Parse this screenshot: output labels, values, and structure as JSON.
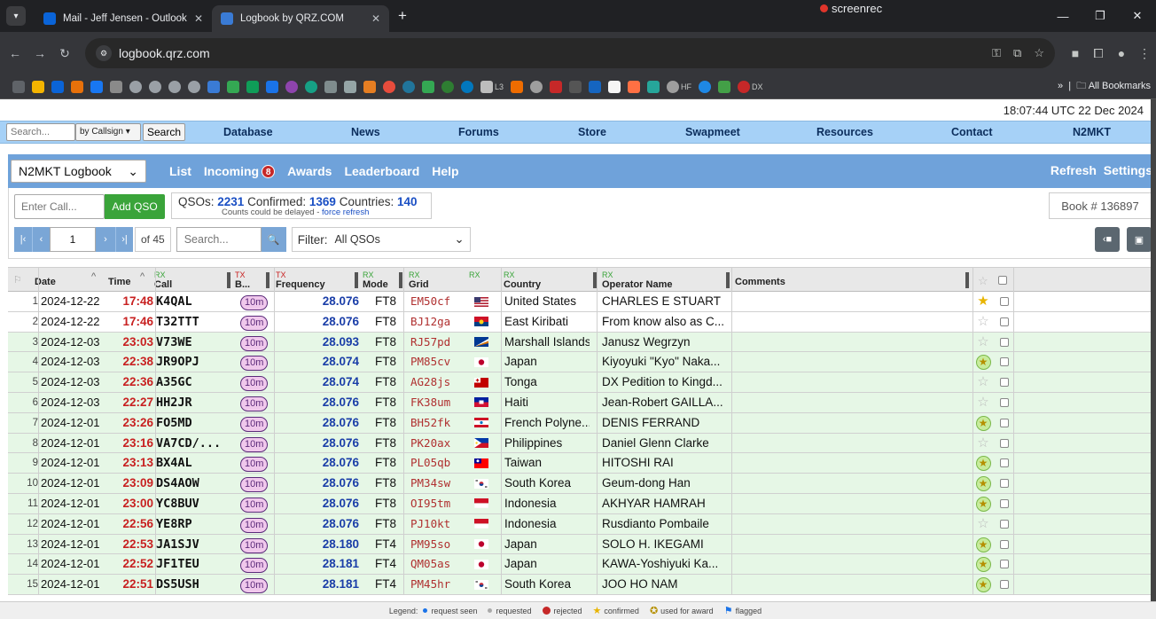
{
  "browser": {
    "tabs": [
      {
        "title": "Mail - Jeff Jensen - Outlook",
        "favicon_color": "#0a64d8"
      },
      {
        "title": "Logbook by QRZ.COM",
        "favicon_color": "#3a7bd5"
      }
    ],
    "recorder_label": "screenrec",
    "url": "logbook.qrz.com",
    "all_bookmarks_label": "All Bookmarks",
    "bookmark_texts": [
      "L3",
      "HF",
      "DX"
    ]
  },
  "utc_time": "18:07:44 UTC 22 Dec 2024",
  "site_menu": {
    "search_placeholder": "Search...",
    "search_type": "by Callsign",
    "search_button": "Search",
    "items": [
      "Database",
      "News",
      "Forums",
      "Store",
      "Swapmeet",
      "Resources",
      "Contact",
      "N2MKT"
    ]
  },
  "logbook_nav": {
    "selected_book": "N2MKT Logbook",
    "links": [
      "List",
      "Incoming",
      "Awards",
      "Leaderboard",
      "Help"
    ],
    "incoming_count": "8",
    "right_links": [
      "Refresh",
      "Settings"
    ]
  },
  "qso_panel": {
    "call_placeholder": "Enter Call...",
    "add_button": "Add QSO",
    "qsos_label": "QSOs:",
    "qsos": "2231",
    "confirmed_label": "Confirmed:",
    "confirmed": "1369",
    "countries_label": "Countries:",
    "countries": "140",
    "delay_note": "Counts could be delayed - ",
    "force_refresh": "force refresh",
    "book_number": "Book # 136897"
  },
  "pager": {
    "page": "1",
    "of_label": "of 45",
    "search_placeholder": "Search...",
    "filter_label": "Filter:",
    "filter_value": "All QSOs"
  },
  "columns": {
    "date": "Date",
    "time": "Time",
    "call": "Call",
    "band": "B...",
    "frequency": "Frequency",
    "mode": "Mode",
    "grid": "Grid",
    "country": "Country",
    "operator": "Operator Name",
    "comments": "Comments",
    "rx": "RX",
    "tx": "TX"
  },
  "rows": [
    {
      "n": "1",
      "date": "2024-12-22",
      "time": "17:48",
      "call": "K4QAL",
      "band": "10m",
      "freq": "28.076",
      "mode": "FT8",
      "grid": "EM50cf",
      "country": "United States",
      "op": "CHARLES E STUART",
      "status": "confirmed",
      "bg": "w",
      "flag": "us"
    },
    {
      "n": "2",
      "date": "2024-12-22",
      "time": "17:46",
      "call": "T32TTT",
      "band": "10m",
      "freq": "28.076",
      "mode": "FT8",
      "grid": "BJ12ga",
      "country": "East Kiribati",
      "op": "From know also as C...",
      "status": "none",
      "bg": "w",
      "flag": "ki"
    },
    {
      "n": "3",
      "date": "2024-12-03",
      "time": "23:03",
      "call": "V73WE",
      "band": "10m",
      "freq": "28.093",
      "mode": "FT8",
      "grid": "RJ57pd",
      "country": "Marshall Islands",
      "op": "Janusz Wegrzyn",
      "status": "none",
      "bg": "g",
      "flag": "mh"
    },
    {
      "n": "4",
      "date": "2024-12-03",
      "time": "22:38",
      "call": "JR9OPJ",
      "band": "10m",
      "freq": "28.074",
      "mode": "FT8",
      "grid": "PM85cv",
      "country": "Japan",
      "op": "Kiyoyuki \"Kyo\" Naka...",
      "status": "used",
      "bg": "g",
      "flag": "jp"
    },
    {
      "n": "5",
      "date": "2024-12-03",
      "time": "22:36",
      "call": "A35GC",
      "band": "10m",
      "freq": "28.074",
      "mode": "FT8",
      "grid": "AG28js",
      "country": "Tonga",
      "op": "DX Pedition to Kingd...",
      "status": "none",
      "bg": "g",
      "flag": "to"
    },
    {
      "n": "6",
      "date": "2024-12-03",
      "time": "22:27",
      "call": "HH2JR",
      "band": "10m",
      "freq": "28.076",
      "mode": "FT8",
      "grid": "FK38um",
      "country": "Haiti",
      "op": "Jean-Robert GAILLA...",
      "status": "none",
      "bg": "g",
      "flag": "ht"
    },
    {
      "n": "7",
      "date": "2024-12-01",
      "time": "23:26",
      "call": "FO5MD",
      "band": "10m",
      "freq": "28.076",
      "mode": "FT8",
      "grid": "BH52fk",
      "country": "French Polyne...",
      "op": "DENIS FERRAND",
      "status": "used",
      "bg": "g",
      "flag": "pf"
    },
    {
      "n": "8",
      "date": "2024-12-01",
      "time": "23:16",
      "call": "VA7CD/...",
      "band": "10m",
      "freq": "28.076",
      "mode": "FT8",
      "grid": "PK20ax",
      "country": "Philippines",
      "op": "Daniel Glenn Clarke",
      "status": "none",
      "bg": "g",
      "flag": "ph"
    },
    {
      "n": "9",
      "date": "2024-12-01",
      "time": "23:13",
      "call": "BX4AL",
      "band": "10m",
      "freq": "28.076",
      "mode": "FT8",
      "grid": "PL05qb",
      "country": "Taiwan",
      "op": "HITOSHI RAI",
      "status": "used",
      "bg": "g",
      "flag": "tw"
    },
    {
      "n": "10",
      "date": "2024-12-01",
      "time": "23:09",
      "call": "DS4AOW",
      "band": "10m",
      "freq": "28.076",
      "mode": "FT8",
      "grid": "PM34sw",
      "country": "South Korea",
      "op": "Geum-dong Han",
      "status": "used",
      "bg": "g",
      "flag": "kr"
    },
    {
      "n": "11",
      "date": "2024-12-01",
      "time": "23:00",
      "call": "YC8BUV",
      "band": "10m",
      "freq": "28.076",
      "mode": "FT8",
      "grid": "OI95tm",
      "country": "Indonesia",
      "op": "AKHYAR HAMRAH",
      "status": "used",
      "bg": "g",
      "flag": "id"
    },
    {
      "n": "12",
      "date": "2024-12-01",
      "time": "22:56",
      "call": "YE8RP",
      "band": "10m",
      "freq": "28.076",
      "mode": "FT8",
      "grid": "PJ10kt",
      "country": "Indonesia",
      "op": "Rusdianto Pombaile",
      "status": "none",
      "bg": "g",
      "flag": "id"
    },
    {
      "n": "13",
      "date": "2024-12-01",
      "time": "22:53",
      "call": "JA1SJV",
      "band": "10m",
      "freq": "28.180",
      "mode": "FT4",
      "grid": "PM95so",
      "country": "Japan",
      "op": "SOLO H. IKEGAMI",
      "status": "used",
      "bg": "g",
      "flag": "jp"
    },
    {
      "n": "14",
      "date": "2024-12-01",
      "time": "22:52",
      "call": "JF1TEU",
      "band": "10m",
      "freq": "28.181",
      "mode": "FT4",
      "grid": "QM05as",
      "country": "Japan",
      "op": "KAWA-Yoshiyuki Ka...",
      "status": "used",
      "bg": "g",
      "flag": "jp"
    },
    {
      "n": "15",
      "date": "2024-12-01",
      "time": "22:51",
      "call": "DS5USH",
      "band": "10m",
      "freq": "28.181",
      "mode": "FT4",
      "grid": "PM45hr",
      "country": "South Korea",
      "op": "JOO HO NAM",
      "status": "used",
      "bg": "g",
      "flag": "kr"
    }
  ],
  "legend": {
    "label": "Legend:",
    "items": [
      "request seen",
      "requested",
      "rejected",
      "confirmed",
      "used for award",
      "flagged"
    ]
  },
  "colors": {
    "menu_blue": "#a6d1f7",
    "logbook_blue": "#6fa2da",
    "confirmed_green": "#e6f7e6",
    "time_red": "#c82121",
    "freq_blue": "#1a3ea8"
  }
}
